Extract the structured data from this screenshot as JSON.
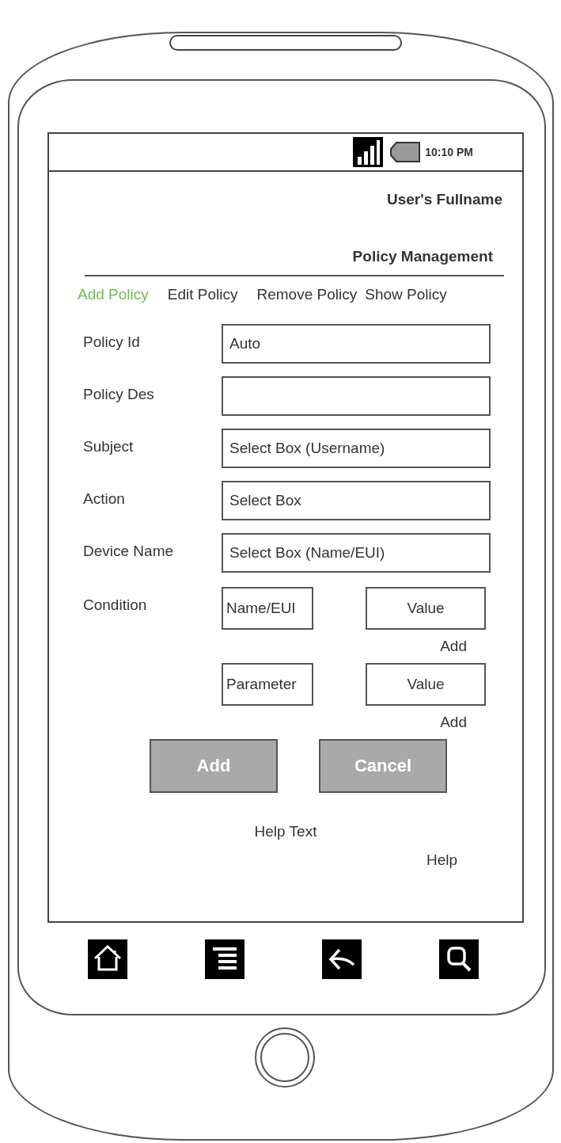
{
  "status_bar": {
    "time": "10:10 PM"
  },
  "header": {
    "user": "User's Fullname",
    "title": "Policy Management"
  },
  "tabs": [
    {
      "label": "Add Policy",
      "selected": true
    },
    {
      "label": "Edit Policy",
      "selected": false
    },
    {
      "label": "Remove Policy",
      "selected": false
    },
    {
      "label": "Show Policy",
      "selected": false
    }
  ],
  "fields": [
    {
      "label": "Policy Id",
      "value": "Auto"
    },
    {
      "label": "Policy Des"
    },
    {
      "label": "Subject",
      "value": "Select Box (Username)"
    },
    {
      "label": "Action",
      "value": "Select Box"
    },
    {
      "label": "Device Name",
      "value": "Select Box (Name/EUI)"
    }
  ],
  "condition": {
    "label": "Condition",
    "rows": [
      {
        "field": "Name/EUI",
        "value": "Value",
        "link": "Add"
      },
      {
        "field": "Parameter",
        "value": "Value",
        "link": "Add"
      }
    ]
  },
  "buttons": [
    "Add",
    "Cancel"
  ],
  "help_text": "Help Text",
  "help_link": "Help"
}
